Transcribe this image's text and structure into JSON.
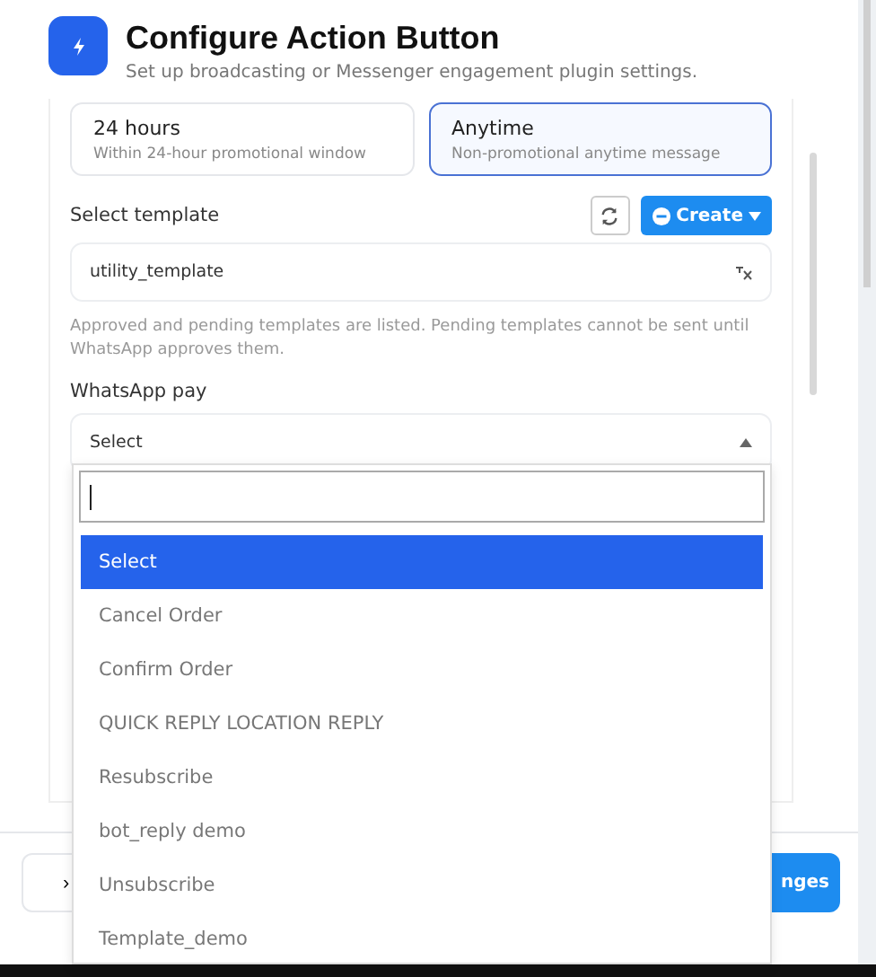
{
  "header": {
    "title": "Configure Action Button",
    "subtitle": "Set up broadcasting or Messenger engagement plugin settings."
  },
  "message_windows": [
    {
      "title": "24 hours",
      "description": "Within 24-hour promotional window",
      "selected": false
    },
    {
      "title": "Anytime",
      "description": "Non-promotional anytime message",
      "selected": true
    }
  ],
  "template": {
    "label": "Select template",
    "value": "utility_template",
    "help": "Approved and pending templates are listed. Pending templates cannot be sent until WhatsApp approves them."
  },
  "create_button": "Create",
  "whatsapp_pay": {
    "label": "WhatsApp pay",
    "value": "Select",
    "expanded": true
  },
  "dropdown": {
    "options": [
      {
        "label": "Select",
        "selected": true
      },
      {
        "label": "Cancel Order",
        "selected": false
      },
      {
        "label": "Confirm Order",
        "selected": false
      },
      {
        "label": "QUICK REPLY LOCATION REPLY",
        "selected": false
      },
      {
        "label": "Resubscribe",
        "selected": false
      },
      {
        "label": "bot_reply demo",
        "selected": false
      },
      {
        "label": "Unsubscribe",
        "selected": false
      },
      {
        "label": "Template_demo",
        "selected": false
      }
    ]
  },
  "footer": {
    "left_button": "›",
    "right_button": "nges"
  }
}
